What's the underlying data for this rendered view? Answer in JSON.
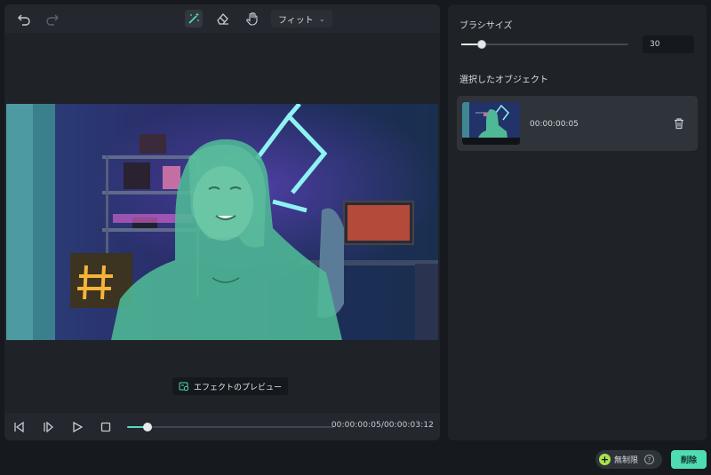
{
  "toolbar": {
    "undo_icon": "undo-icon",
    "redo_icon": "redo-icon",
    "smart_brush_icon": "magic-brush-icon",
    "eraser_icon": "eraser-icon",
    "hand_icon": "hand-icon",
    "zoom_label": "フィット"
  },
  "viewer": {
    "preview_label": "エフェクトのプレビュー",
    "preview_icon": "preview-effect-icon"
  },
  "playback": {
    "timecode": "00:00:00:05/00:00:03:12",
    "progress_fraction": 0.1
  },
  "panel": {
    "brush_size_label": "ブラシサイズ",
    "brush_size_value": "30",
    "brush_size_fraction": 0.12,
    "selected_objects_label": "選択したオブジェクト",
    "objects": [
      {
        "time": "00:00:00:05"
      }
    ]
  },
  "footer": {
    "unlimited_label": "無制限",
    "delete_label": "削除"
  },
  "colors": {
    "accent": "#4ee0b9",
    "panel_bg": "#1f2328",
    "app_bg": "#16191e",
    "mask_overlay": "#4fb996"
  }
}
